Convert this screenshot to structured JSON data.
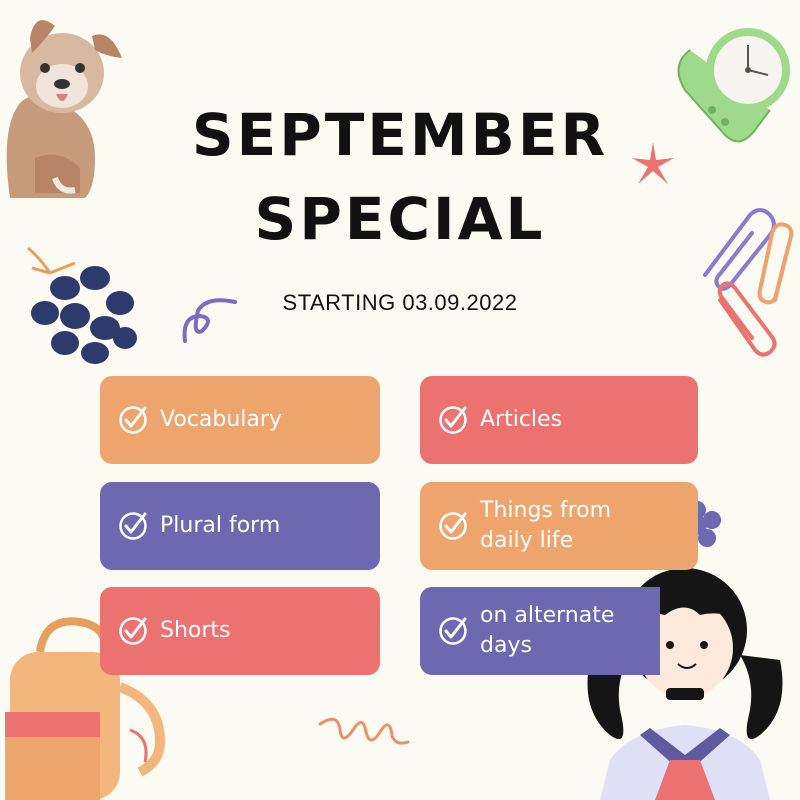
{
  "title_line1": "SEPTEMBER",
  "title_line2": "SPECIAL",
  "subtitle": "STARTING 03.09.2022",
  "colors": {
    "orange": "#eea46d",
    "red": "#ec7171",
    "purple": "#6d68b0",
    "background": "#fbfbf3"
  },
  "cards": [
    {
      "label": "Vocabulary",
      "color": "orange"
    },
    {
      "label": "Articles",
      "color": "red"
    },
    {
      "label": "Plural form",
      "color": "purple"
    },
    {
      "label_line1": "Things from",
      "label_line2": "daily life",
      "color": "orange"
    },
    {
      "label": "Shorts",
      "color": "red"
    },
    {
      "label_line1": "on alternate",
      "label_line2": "days",
      "color": "purple"
    }
  ],
  "icons": [
    "check-circle-icon",
    "dog-illustration",
    "wristwatch-illustration",
    "grapes-illustration",
    "paperclip-icon",
    "star-icon",
    "squiggle-icon",
    "flower-icon",
    "backpack-illustration",
    "girl-illustration"
  ]
}
